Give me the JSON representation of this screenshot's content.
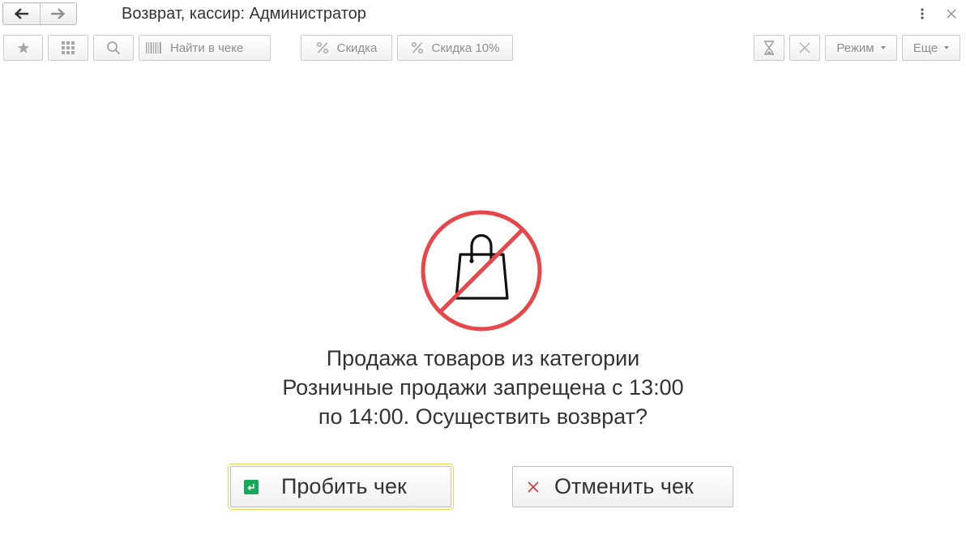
{
  "window": {
    "title": "Возврат, кассир: Администратор",
    "nav": {
      "back_icon": "arrow-left-icon",
      "forward_icon": "arrow-right-icon"
    },
    "more_icon": "vertical-ellipsis-icon",
    "close_icon": "close-icon"
  },
  "toolbar": {
    "favorite_icon": "star-icon",
    "grid_icon": "grid-icon",
    "search_icon": "search-icon",
    "find_in_receipt": "Найти в чеке",
    "discount": "Скидка",
    "discount_10": "Скидка 10%",
    "postpone_icon": "hourglass-icon",
    "clear_icon": "close-icon",
    "mode": "Режим",
    "more": "Еще"
  },
  "dialog": {
    "icon": "no-shopping-bag-icon",
    "message": "Продажа товаров из категории Розничные продажи запрещена с 13:00 по 14:00. Осуществить возврат?",
    "confirm_label": "Пробить чек",
    "cancel_label": "Отменить чек"
  },
  "colors": {
    "prohibition_red": "#e8474a",
    "enter_badge_green": "#18a85b",
    "default_button_outline": "#e8d44a",
    "cancel_icon_red": "#d9363e"
  }
}
